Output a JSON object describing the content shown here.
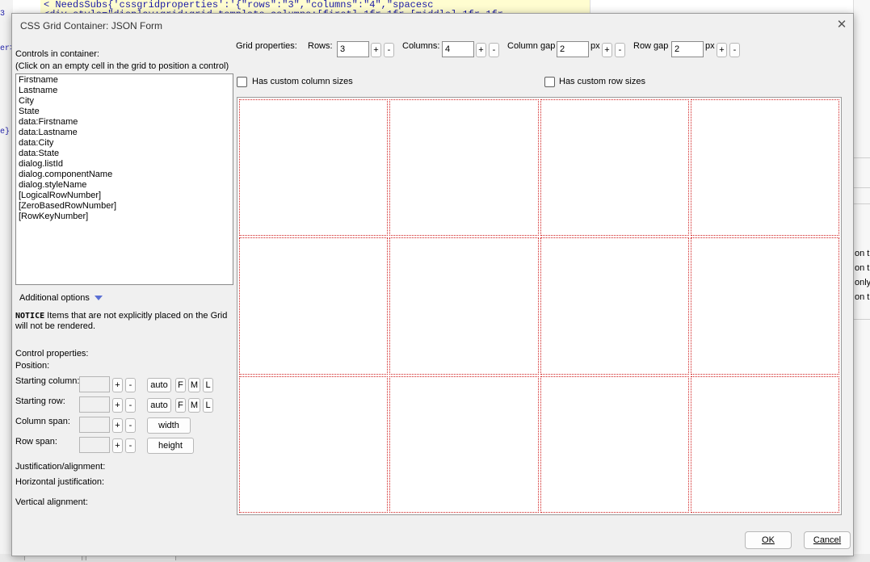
{
  "background": {
    "code_lines": [
      "<  NeedsSubs{'cssgridproperties':'{\"rows\":\"3\",\"columns\":\"4\",\"spacesc",
      "<div  style=\"display:grid;grid-template-columns:[first] 1fr 1fr [middle] 1fr 1fr"
    ],
    "left_fragments": [
      "3",
      "er>",
      "e}"
    ],
    "right_fragments": [
      "on t",
      "on t",
      "only",
      "on t"
    ]
  },
  "dialog": {
    "title": "CSS Grid Container: JSON Form",
    "close_glyph": "✕",
    "controls_header": "Controls in container:",
    "controls_hint": "(Click on an empty cell in the grid to position a control)",
    "controls": [
      "Firstname",
      "Lastname",
      "City",
      "State",
      "data:Firstname",
      "data:Lastname",
      "data:City",
      "data:State",
      "dialog.listId",
      "dialog.componentName",
      "dialog.styleName",
      "[LogicalRowNumber]",
      "[ZeroBasedRowNumber]",
      "[RowKeyNumber]"
    ],
    "additional_options": "Additional options",
    "notice_label": "NOTICE",
    "notice_text": " Items that are not explicitly placed on the Grid will not be rendered.",
    "control_properties": "Control properties:",
    "position": "Position:",
    "starting_column": "Starting column:",
    "starting_row": "Starting row:",
    "column_span": "Column span:",
    "row_span": "Row span:",
    "auto": "auto",
    "f": "F",
    "m": "M",
    "l": "L",
    "width": "width",
    "height": "height",
    "plus": "+",
    "minus": "-",
    "justification_alignment": "Justification/alignment:",
    "horizontal_justification": "Horizontal justification:",
    "vertical_alignment": "Vertical alignment:",
    "grid_properties": "Grid properties:",
    "rows_label": "Rows:",
    "rows_value": "3",
    "columns_label": "Columns:",
    "columns_value": "4",
    "column_gap_label": "Column gap",
    "column_gap_value": "2",
    "row_gap_label": "Row gap",
    "row_gap_value": "2",
    "px": "px",
    "custom_column_sizes": "Has custom column sizes",
    "custom_row_sizes": "Has custom row sizes",
    "ok": "OK",
    "cancel": "Cancel",
    "grid_rows": 3,
    "grid_columns": 4
  }
}
